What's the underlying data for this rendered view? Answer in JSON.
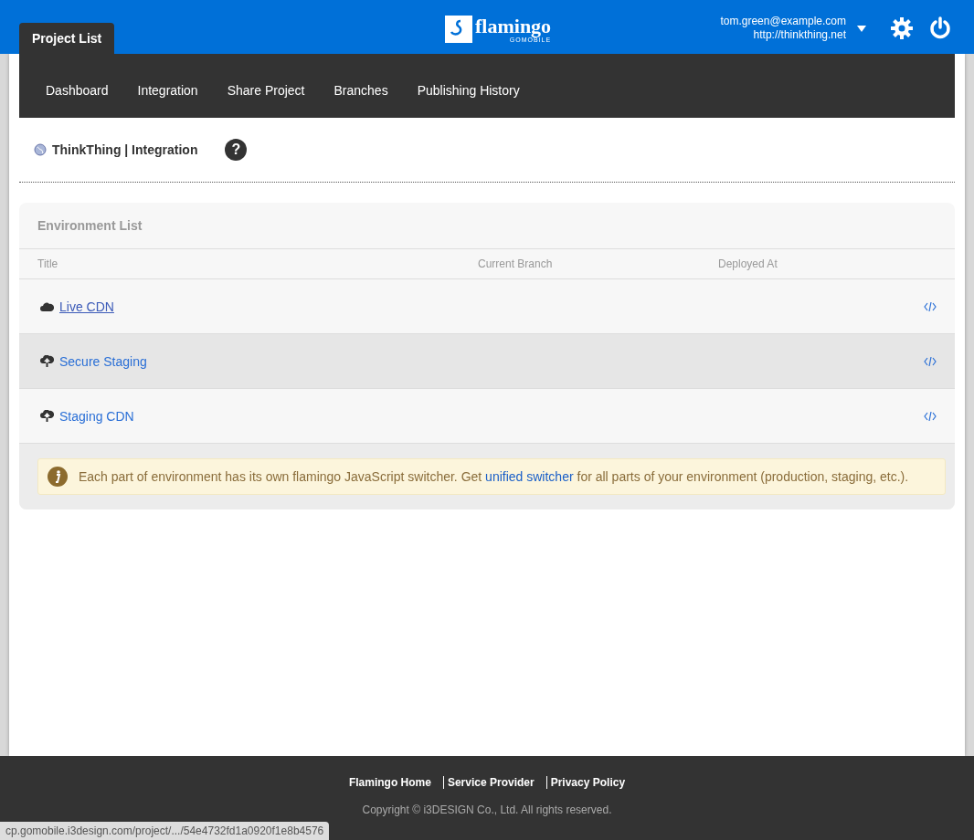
{
  "header": {
    "tab": "Project List",
    "logo": {
      "name": "flamingo",
      "sub": "GOMOBILE"
    },
    "user": {
      "email": "tom.green@example.com",
      "site": "http://thinkthing.net"
    }
  },
  "nav": [
    "Dashboard",
    "Integration",
    "Share Project",
    "Branches",
    "Publishing History"
  ],
  "breadcrumb": "ThinkThing | Integration",
  "help": "?",
  "panel": {
    "title": "Environment List",
    "columns": [
      "Title",
      "Current Branch",
      "Deployed At"
    ],
    "rows": [
      {
        "title": "Live CDN",
        "kind": "cloud",
        "highlighted": false,
        "link_hovered": true
      },
      {
        "title": "Secure Staging",
        "kind": "upload",
        "highlighted": true,
        "link_hovered": false
      },
      {
        "title": "Staging CDN",
        "kind": "upload",
        "highlighted": false,
        "link_hovered": false
      }
    ],
    "notice": {
      "before": "Each part of environment has its own flamingo JavaScript switcher. Get",
      "link": "unified switcher",
      "after": "for all parts of your environment (production, staging, etc.)."
    }
  },
  "footer": {
    "links": [
      "Flamingo Home",
      "Service Provider",
      "Privacy Policy"
    ],
    "copyright": "Copyright © i3DESIGN Co., Ltd. All rights reserved."
  },
  "status_url": "cp.gomobile.i3design.com/project/.../54e4732fd1a0920f1e8b4576"
}
